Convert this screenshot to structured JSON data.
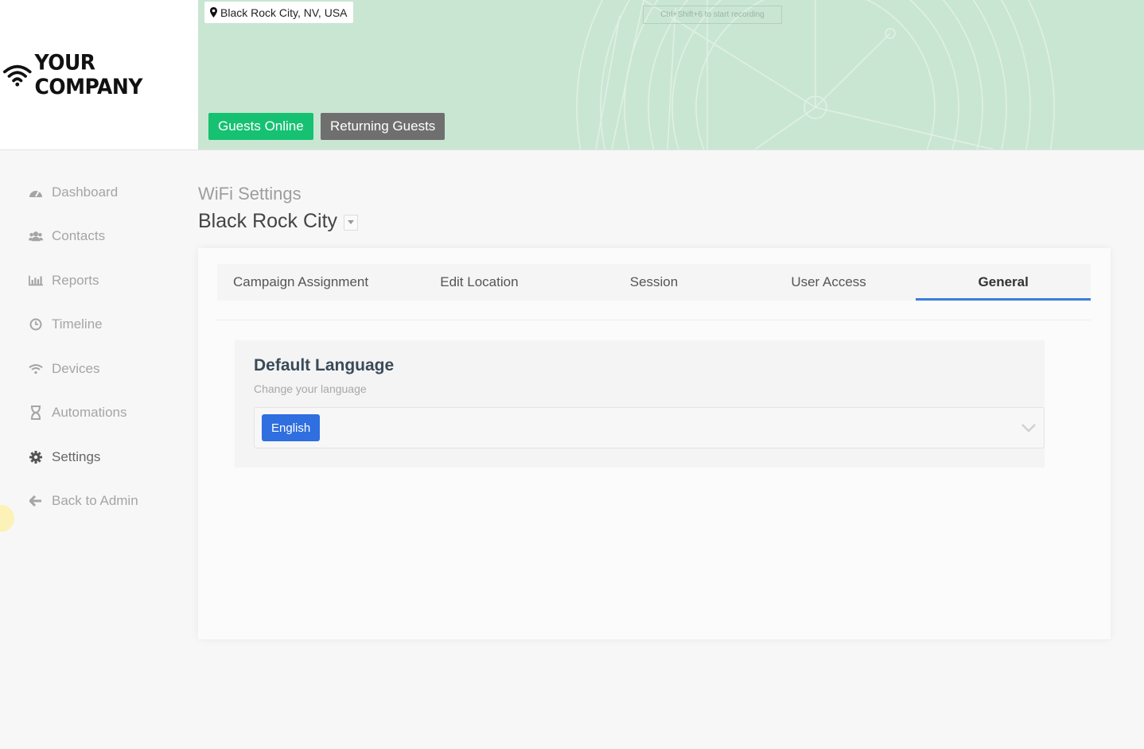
{
  "header": {
    "company_name": "YOUR COMPANY",
    "location_chip": "Black Rock City, NV, USA",
    "recording_hint": "Ctrl+Shift+6 to start recording",
    "guests_online_label": "Guests Online",
    "returning_guests_label": "Returning Guests"
  },
  "colors": {
    "accent": "#3b7ddd",
    "guests_online": "#16c172",
    "returning_guests": "#6f6f6f",
    "map_bg": "#c9e6d3",
    "chip_blue": "#2f6fe0"
  },
  "sidebar": {
    "items": [
      {
        "label": "Dashboard",
        "icon": "tachometer-icon",
        "active": false
      },
      {
        "label": "Contacts",
        "icon": "users-icon",
        "active": false
      },
      {
        "label": "Reports",
        "icon": "bar-chart-icon",
        "active": false
      },
      {
        "label": "Timeline",
        "icon": "clock-icon",
        "active": false
      },
      {
        "label": "Devices",
        "icon": "wifi-icon",
        "active": false
      },
      {
        "label": "Automations",
        "icon": "hourglass-icon",
        "active": false
      },
      {
        "label": "Settings",
        "icon": "gear-icon",
        "active": true
      },
      {
        "label": "Back to Admin",
        "icon": "arrow-left-icon",
        "active": false
      }
    ]
  },
  "main": {
    "subtitle": "WiFi Settings",
    "title": "Black Rock City",
    "tabs": [
      {
        "label": "Campaign Assignment",
        "active": false
      },
      {
        "label": "Edit Location",
        "active": false
      },
      {
        "label": "Session",
        "active": false
      },
      {
        "label": "User Access",
        "active": false
      },
      {
        "label": "General",
        "active": true
      }
    ],
    "section": {
      "title": "Default Language",
      "subtitle": "Change your language",
      "selected_language": "English"
    }
  }
}
